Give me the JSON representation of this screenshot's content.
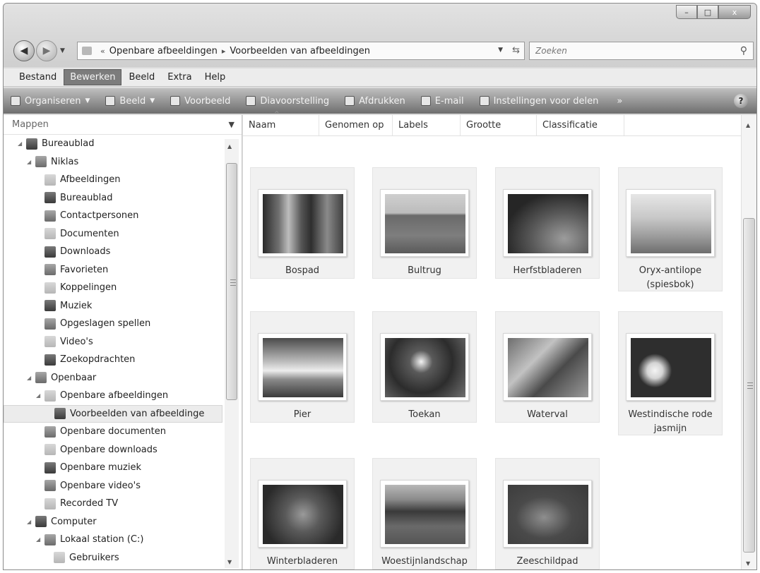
{
  "window": {
    "controls": {
      "minimize": "–",
      "maximize": "□",
      "close": "x"
    }
  },
  "address": {
    "crumbs": [
      "Openbare afbeeldingen",
      "Voorbeelden van afbeeldingen"
    ],
    "prefix": "«",
    "separator": "▸"
  },
  "search": {
    "placeholder": "Zoeken"
  },
  "menubar": [
    "Bestand",
    "Bewerken",
    "Beeld",
    "Extra",
    "Help"
  ],
  "menubar_active": "Bewerken",
  "commandbar": {
    "organize": "Organiseren",
    "view": "Beeld",
    "preview": "Voorbeeld",
    "slideshow": "Diavoorstelling",
    "print": "Afdrukken",
    "email": "E-mail",
    "share": "Instellingen voor delen",
    "more": "»",
    "help": "?"
  },
  "navpane": {
    "header": "Mappen",
    "tree": [
      {
        "label": "Bureaublad",
        "level": 0
      },
      {
        "label": "Niklas",
        "level": 1
      },
      {
        "label": "Afbeeldingen",
        "level": 2
      },
      {
        "label": "Bureaublad",
        "level": 2
      },
      {
        "label": "Contactpersonen",
        "level": 2
      },
      {
        "label": "Documenten",
        "level": 2
      },
      {
        "label": "Downloads",
        "level": 2
      },
      {
        "label": "Favorieten",
        "level": 2
      },
      {
        "label": "Koppelingen",
        "level": 2
      },
      {
        "label": "Muziek",
        "level": 2
      },
      {
        "label": "Opgeslagen spellen",
        "level": 2
      },
      {
        "label": "Video's",
        "level": 2
      },
      {
        "label": "Zoekopdrachten",
        "level": 2
      },
      {
        "label": "Openbaar",
        "level": 1
      },
      {
        "label": "Openbare afbeeldingen",
        "level": 2
      },
      {
        "label": "Voorbeelden van afbeeldinge",
        "level": 3,
        "selected": true
      },
      {
        "label": "Openbare documenten",
        "level": 2
      },
      {
        "label": "Openbare downloads",
        "level": 2
      },
      {
        "label": "Openbare muziek",
        "level": 2
      },
      {
        "label": "Openbare video's",
        "level": 2
      },
      {
        "label": "Recorded TV",
        "level": 2
      },
      {
        "label": "Computer",
        "level": 1
      },
      {
        "label": "Lokaal station (C:)",
        "level": 2
      },
      {
        "label": "Gebruikers",
        "level": 3
      }
    ]
  },
  "columns": [
    "Naam",
    "Genomen op",
    "Labels",
    "Grootte",
    "Classificatie"
  ],
  "files": [
    {
      "name": "Bospad",
      "photo": "p-bospad"
    },
    {
      "name": "Bultrug",
      "photo": "p-bultrug"
    },
    {
      "name": "Herfstbladeren",
      "photo": "p-herfst"
    },
    {
      "name": "Oryx-antilope (spiesbok)",
      "photo": "p-oryx"
    },
    {
      "name": "Pier",
      "photo": "p-pier"
    },
    {
      "name": "Toekan",
      "photo": "p-toekan"
    },
    {
      "name": "Waterval",
      "photo": "p-waterval"
    },
    {
      "name": "Westindische rode jasmijn",
      "photo": "p-jasmijn"
    },
    {
      "name": "Winterbladeren",
      "photo": "p-winter"
    },
    {
      "name": "Woestijnlandschap",
      "photo": "p-woestijn"
    },
    {
      "name": "Zeeschildpad",
      "photo": "p-zeeschild"
    }
  ]
}
